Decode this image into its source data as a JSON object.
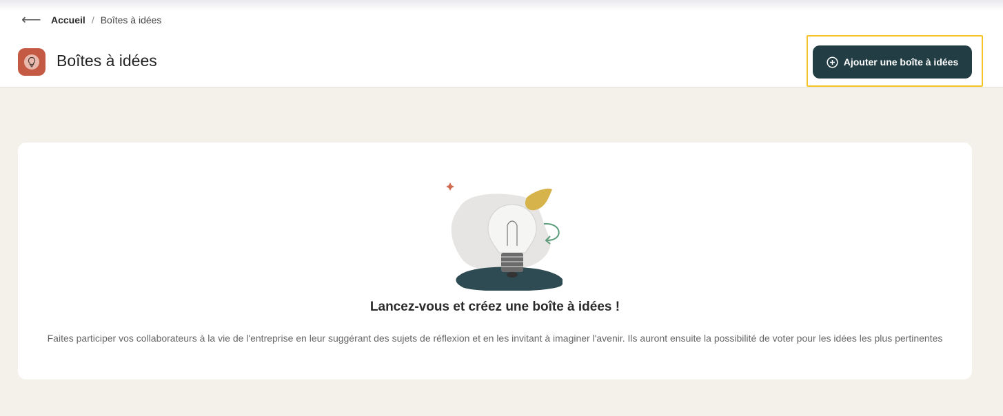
{
  "breadcrumb": {
    "home": "Accueil",
    "separator": "/",
    "current": "Boîtes à idées"
  },
  "header": {
    "title": "Boîtes à idées",
    "icon": "lightbulb-icon",
    "add_button_label": "Ajouter une boîte à idées"
  },
  "empty_state": {
    "title": "Lancez-vous et créez une boîte à idées !",
    "description": "Faites participer vos collaborateurs à la vie de l'entreprise en leur suggérant des sujets de réflexion et en les invitant à imaginer l'avenir. Ils auront ensuite la possibilité de voter pour les idées les plus pertinentes"
  },
  "colors": {
    "page_icon_bg": "#c45a43",
    "button_bg": "#233d45",
    "highlight": "#f5c527",
    "page_bg": "#f4f1ea"
  }
}
